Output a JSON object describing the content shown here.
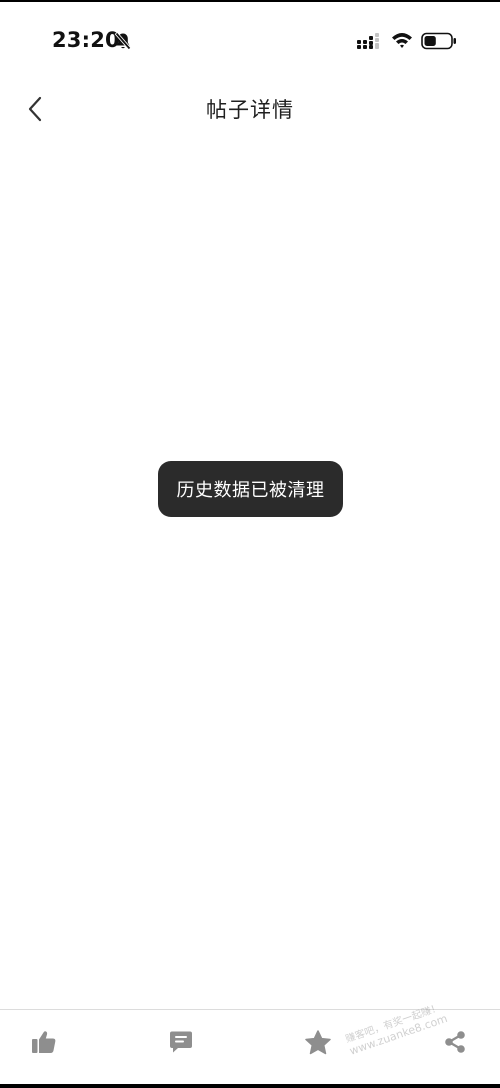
{
  "status_bar": {
    "time": "23:20"
  },
  "nav": {
    "title": "帖子详情"
  },
  "toast": {
    "message": "历史数据已被清理"
  },
  "watermark": {
    "line1": "赚客吧，有奖一起赚！",
    "line2": "www.zuanke8.com"
  },
  "icons": {
    "status": [
      "bell-slash-icon",
      "signal-icon",
      "wifi-icon",
      "battery-icon"
    ],
    "nav": [
      "chevron-left-icon"
    ],
    "bottom": [
      "thumbs-up-icon",
      "comment-icon",
      "star-icon",
      "share-icon"
    ]
  },
  "colors": {
    "toast_bg": "#2b2b2b",
    "icon_gray": "#8e8e8e",
    "title": "#1f1f1f",
    "background": "#ffffff"
  },
  "battery": {
    "level": 0.45
  }
}
